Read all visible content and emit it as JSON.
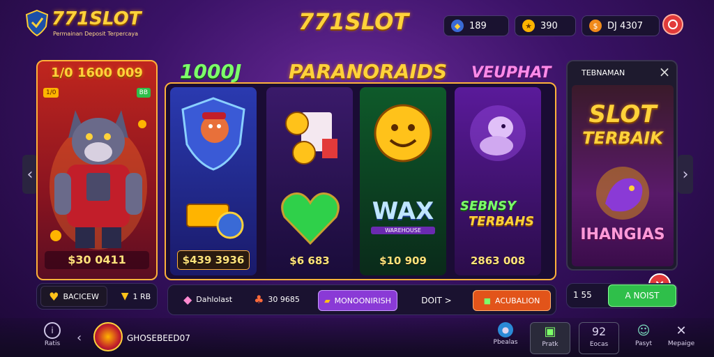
{
  "brand": {
    "logo_text": "771SLOT",
    "tagline": "Permainan Deposit Terpercaya"
  },
  "header": {
    "center_logo": "771SLOT"
  },
  "balances": [
    {
      "icon": "shield-icon",
      "value": "189"
    },
    {
      "icon": "star-icon",
      "value": "390"
    },
    {
      "icon": "coin-bag-icon",
      "value": "DJ 4307"
    }
  ],
  "titles": {
    "left": "1000J",
    "center": "PARANORAIDS",
    "right": "VEUPHAT"
  },
  "featured": {
    "title": "1/0 1600 009",
    "badge_left": "1/0",
    "badge_right": "BB",
    "prize": "$30 0411"
  },
  "games": [
    {
      "prize": "$439 3936"
    },
    {
      "prize": "$6 683"
    },
    {
      "prize": "$10 909"
    },
    {
      "prize": "2863 008"
    }
  ],
  "game_art_text": {
    "wax": "WAX",
    "wax_sub": "WAREHOUSE",
    "sebns_1": "SEBNSY",
    "sebns_2": "TERBAHS"
  },
  "side_panel": {
    "title": "TEBNAMAN",
    "slot_text_1": "SLOT",
    "slot_text_2": "TERBAIK",
    "game_name": "IHANGIAS",
    "amount": "1 55",
    "button": "A NOIST"
  },
  "left_controls": {
    "label": "BACICEW",
    "label2": "1 RB"
  },
  "mid_controls": {
    "item1": "Dahlolast",
    "item2": "30 9685",
    "button1": "MONOONIRISH",
    "link": "DOIT >",
    "button2": "ACUBALION"
  },
  "profile": {
    "name": "GHOSEBEED07"
  },
  "bottom_nav": [
    {
      "icon": "info-icon",
      "label": "Ratis"
    },
    {
      "icon": "globe-icon",
      "label": "Pbealas"
    },
    {
      "icon": "gift-icon",
      "label": "Pratk"
    },
    {
      "icon": "grid-icon",
      "label": "Eocas",
      "top": "92"
    },
    {
      "icon": "chat-icon",
      "label": "Pasyt"
    },
    {
      "icon": "tools-icon",
      "label": "Mepaige"
    }
  ],
  "colors": {
    "accent_gold": "#ffd23a",
    "accent_red": "#e23a3a",
    "accent_green": "#2fbf4a",
    "accent_purple": "#7a3ad6"
  }
}
